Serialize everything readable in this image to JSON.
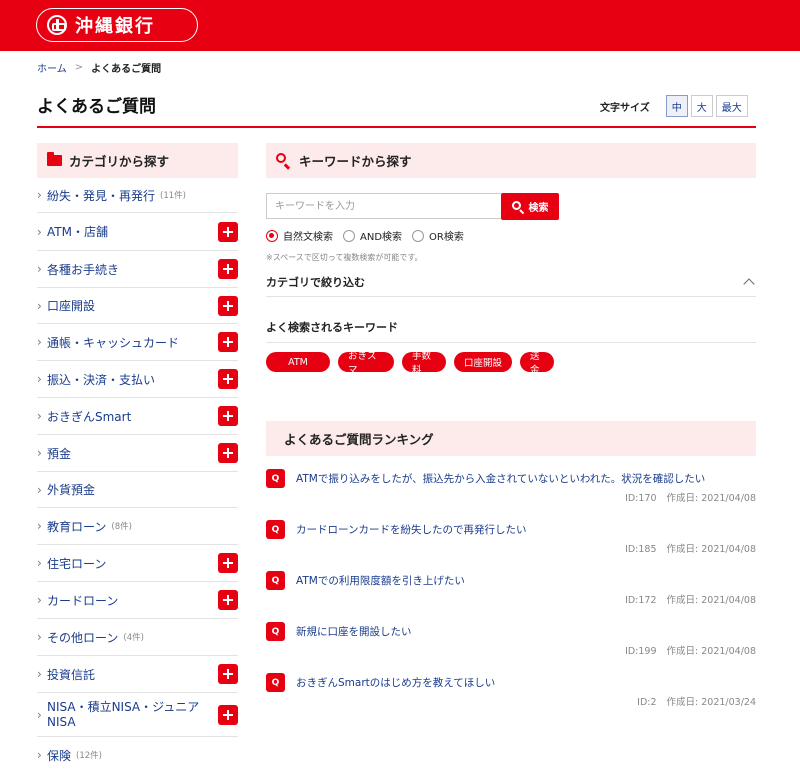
{
  "brand": {
    "name": "沖縄銀行"
  },
  "breadcrumb": {
    "home": "ホーム",
    "separator": ">",
    "current": "よくあるご質問"
  },
  "page": {
    "title": "よくあるご質問"
  },
  "font_size": {
    "label": "文字サイズ",
    "options": [
      "中",
      "大",
      "最大"
    ],
    "selected": "中"
  },
  "sidebar": {
    "heading": "カテゴリから探す",
    "items": [
      {
        "label": "紛失・発見・再発行",
        "count": "(11件)",
        "expandable": false
      },
      {
        "label": "ATM・店舗",
        "count": "",
        "expandable": true
      },
      {
        "label": "各種お手続き",
        "count": "",
        "expandable": true
      },
      {
        "label": "口座開設",
        "count": "",
        "expandable": true
      },
      {
        "label": "通帳・キャッシュカード",
        "count": "",
        "expandable": true
      },
      {
        "label": "振込・決済・支払い",
        "count": "",
        "expandable": true
      },
      {
        "label": "おきぎんSmart",
        "count": "",
        "expandable": true
      },
      {
        "label": "預金",
        "count": "",
        "expandable": true
      },
      {
        "label": "外貨預金",
        "count": "",
        "expandable": false
      },
      {
        "label": "教育ローン",
        "count": "(8件)",
        "expandable": false
      },
      {
        "label": "住宅ローン",
        "count": "",
        "expandable": true
      },
      {
        "label": "カードローン",
        "count": "",
        "expandable": true
      },
      {
        "label": "その他ローン",
        "count": "(4件)",
        "expandable": false
      },
      {
        "label": "投資信託",
        "count": "",
        "expandable": true
      },
      {
        "label": "NISA・積立NISA・ジュニアNISA",
        "count": "",
        "expandable": true
      },
      {
        "label": "保険",
        "count": "(12件)",
        "expandable": false
      }
    ]
  },
  "search": {
    "heading": "キーワードから探す",
    "placeholder": "キーワードを入力",
    "button": "検索",
    "modes": [
      "自然文検索",
      "AND検索",
      "OR検索"
    ],
    "selected_mode": "自然文検索",
    "note": "※スペースで区切って複数検索が可能です。",
    "narrow_label": "カテゴリで絞り込む",
    "popular_label": "よく検索されるキーワード",
    "popular_keywords": [
      "ATM",
      "おきスマ",
      "手数料",
      "口座開設",
      "送金"
    ]
  },
  "ranking": {
    "heading": "よくあるご質問ランキング",
    "badge": "Q",
    "items": [
      {
        "question": "ATMで振り込みをしたが、振込先から入金されていないといわれた。状況を確認したい",
        "id": "ID:170",
        "date": "作成日: 2021/04/08"
      },
      {
        "question": "カードローンカードを紛失したので再発行したい",
        "id": "ID:185",
        "date": "作成日: 2021/04/08"
      },
      {
        "question": "ATMでの利用限度額を引き上げたい",
        "id": "ID:172",
        "date": "作成日: 2021/04/08"
      },
      {
        "question": "新規に口座を開設したい",
        "id": "ID:199",
        "date": "作成日: 2021/04/08"
      },
      {
        "question": "おきぎんSmartのはじめ方を教えてほしい",
        "id": "ID:2",
        "date": "作成日: 2021/03/24"
      }
    ]
  },
  "colors": {
    "brand_red": "#e60012",
    "link_blue": "#1a3c8c",
    "pale_pink": "#fdeaea"
  }
}
